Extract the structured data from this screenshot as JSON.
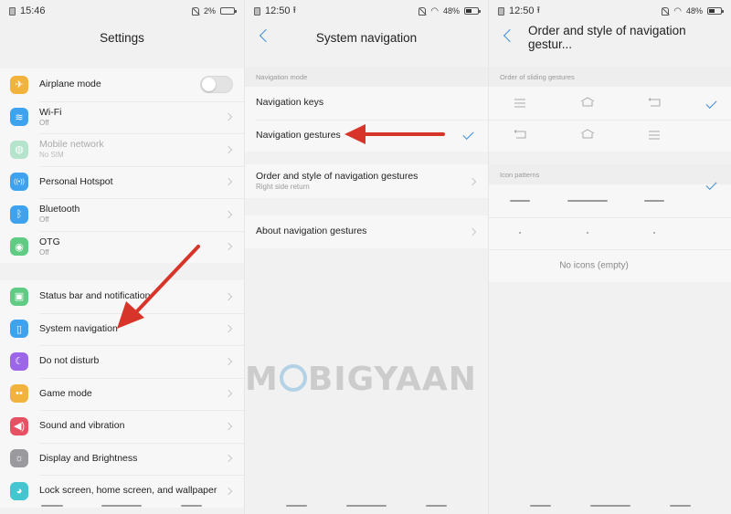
{
  "panels": [
    {
      "status": {
        "time": "15:46",
        "battery": "2%",
        "battery_level": 0.02,
        "wifi": false,
        "upload": false
      },
      "title": "Settings",
      "groups": [
        [
          {
            "label": "Airplane mode",
            "icon": "airplane-icon",
            "color": "#f2b33d",
            "glyph": "✈",
            "control": "toggle",
            "toggle_on": false
          },
          {
            "label": "Wi-Fi",
            "sub": "Off",
            "icon": "wifi-icon",
            "color": "#3ea2ee",
            "glyph": "≋",
            "control": "chevron"
          },
          {
            "label": "Mobile network",
            "sub": "No SIM",
            "icon": "globe-icon",
            "color": "#b5e3cc",
            "glyph": "◍",
            "control": "chevron",
            "disabled": true
          },
          {
            "label": "Personal Hotspot",
            "icon": "hotspot-icon",
            "color": "#3ea2ee",
            "glyph": "((•))",
            "control": "chevron"
          },
          {
            "label": "Bluetooth",
            "sub": "Off",
            "icon": "bluetooth-icon",
            "color": "#3ea2ee",
            "glyph": "ᛒ",
            "control": "chevron"
          },
          {
            "label": "OTG",
            "sub": "Off",
            "icon": "otg-icon",
            "color": "#5fcb83",
            "glyph": "◉",
            "control": "chevron"
          }
        ],
        [
          {
            "label": "Status bar and notification",
            "icon": "notification-icon",
            "color": "#5fcb83",
            "glyph": "▣",
            "control": "chevron"
          },
          {
            "label": "System navigation",
            "icon": "system-navigation-icon",
            "color": "#3ea2ee",
            "glyph": "▯",
            "control": "chevron"
          },
          {
            "label": "Do not disturb",
            "icon": "moon-icon",
            "color": "#9b66e8",
            "glyph": "☾",
            "control": "chevron"
          },
          {
            "label": "Game mode",
            "icon": "game-icon",
            "color": "#f2b33d",
            "glyph": "••",
            "control": "chevron"
          },
          {
            "label": "Sound and vibration",
            "icon": "speaker-icon",
            "color": "#e55063",
            "glyph": "◀)",
            "control": "chevron"
          },
          {
            "label": "Display and Brightness",
            "icon": "brightness-icon",
            "color": "#9a9a9e",
            "glyph": "☼",
            "control": "chevron"
          },
          {
            "label": "Lock screen, home screen, and wallpaper",
            "icon": "palette-icon",
            "color": "#43c6cf",
            "glyph": "◕",
            "control": "chevron"
          }
        ]
      ]
    },
    {
      "status": {
        "time": "12:50",
        "battery": "48%",
        "battery_level": 0.48,
        "wifi": true,
        "upload": true
      },
      "title": "System navigation",
      "section_label": "Navigation mode",
      "mode_options": [
        {
          "label": "Navigation keys",
          "selected": false
        },
        {
          "label": "Navigation gestures",
          "selected": true
        }
      ],
      "order_item": {
        "label": "Order and style of navigation gestures",
        "sub": "Right side return"
      },
      "about_item": {
        "label": "About navigation gestures"
      }
    },
    {
      "status": {
        "time": "12:50",
        "battery": "48%",
        "battery_level": 0.48,
        "wifi": true,
        "upload": true
      },
      "title": "Order and style of navigation gestur...",
      "order_label": "Order of sliding gestures",
      "orders": [
        {
          "icons": [
            "menu-icon",
            "home-icon",
            "back-icon"
          ],
          "selected": true
        },
        {
          "icons": [
            "back-icon",
            "home-icon",
            "menu-icon"
          ],
          "selected": false
        }
      ],
      "patterns_label": "Icon patterns",
      "patterns": [
        {
          "style": "bars",
          "selected": true
        },
        {
          "style": "dots",
          "selected": false
        },
        {
          "style": "empty",
          "label": "No icons (empty)",
          "selected": false
        }
      ]
    }
  ],
  "watermark": {
    "text_left": "M",
    "text_right": "BIGYAAN"
  },
  "annotations": {
    "arrow_color": "#d8352a"
  }
}
